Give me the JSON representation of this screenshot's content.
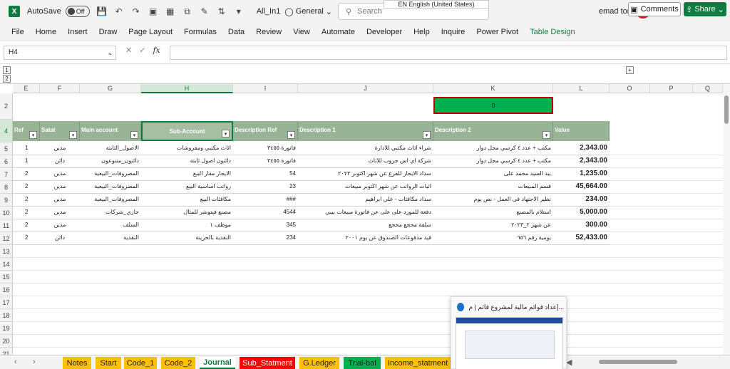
{
  "titlebar": {
    "autosave_label": "AutoSave",
    "autosave_state": "Off",
    "file_name": "All_In1",
    "sensitivity": "General",
    "search_placeholder": "Search",
    "language_popup": "EN English (United States)",
    "user_name": "emad tonsy",
    "avatar_initial": "e"
  },
  "ribbon": {
    "tabs": [
      "File",
      "Home",
      "Insert",
      "Draw",
      "Page Layout",
      "Formulas",
      "Data",
      "Review",
      "View",
      "Automate",
      "Developer",
      "Help",
      "Inquire",
      "Power Pivot",
      "Table Design"
    ],
    "comments_label": "Comments",
    "share_label": "Share"
  },
  "formula_bar": {
    "name_box": "H4",
    "formula": ""
  },
  "outline": {
    "level1": "1",
    "level2": "2",
    "expand": "+"
  },
  "columns": [
    "E",
    "F",
    "G",
    "H",
    "I",
    "J",
    "K",
    "L",
    "O",
    "P",
    "Q"
  ],
  "rows": [
    "2",
    "4",
    "5",
    "6",
    "7",
    "8",
    "9",
    "10",
    "11",
    "12",
    "13",
    "14",
    "15",
    "16",
    "17",
    "18",
    "19",
    "20",
    "21"
  ],
  "green_cell_value": "0",
  "table": {
    "headers": [
      "Ref",
      "Satat",
      "Main account",
      "Sub-Account",
      "Description Ref",
      "Description 1",
      "Description 2",
      "Value"
    ],
    "rows": [
      [
        "1",
        "مدين",
        "الاصول_الثابتة",
        "اثاث مكتبي ومفروشات",
        "فاتورة ٣٤٥٥",
        "شراء اثاث مكتبي للادارة",
        "مكتب + عدد ٤ كرسي مجل دوار",
        "2,343.00"
      ],
      [
        "1",
        "دائن",
        "دائنون_متنوعون",
        "دائنون اصول ثابتة",
        "فاتورة ٣٤٥٥",
        "شركة اي اس جروب للاثاث",
        "مكتب + عدد ٤ كرسي مجل دوار",
        "2,343.00"
      ],
      [
        "2",
        "مدين",
        "المصروفات_البيعية",
        "الايجار مقار البيع",
        "54",
        "سداد الايجار للفرع عن شهر اكتوبر ٢٠٢٣",
        "بيد السيد محمد على",
        "1,235.00"
      ],
      [
        "2",
        "مدين",
        "المصروفات_البيعية",
        "رواتب اساسية البيع",
        "23",
        "اثبات الرواتب عن شهر اكتوبر مبيعات",
        "قسم المبيعات",
        "45,664.00"
      ],
      [
        "2",
        "مدين",
        "المصروفات_البيعية",
        "مكافئات البيع",
        "###",
        "سداد مكافئات - على ابراهيم",
        "نظير الاجتهاد فى العمل - نص يوم",
        "234.00"
      ],
      [
        "2",
        "مدين",
        "جاري_شركات",
        "مصنع فيتوشر للمثال",
        "4544",
        "دفعة للمورد على على عن فاتورة مبيعات بيبي",
        "استلام بالمصنع",
        "5,000.00"
      ],
      [
        "2",
        "مدين",
        "السلف",
        "موظف ١",
        "345",
        "سلفة محجع محجع",
        "عن شهر ٢_٢٠٢٣",
        "300.00"
      ],
      [
        "2",
        "دائن",
        "النقدية",
        "النقدية بالخزينة",
        "234",
        "قيد مدفوعات الصندوق عن يوم ٢٠٠١",
        "يومية رقم ٦٥٦",
        "52,433.00"
      ]
    ]
  },
  "sheet_tabs": [
    {
      "label": "Notes",
      "color": "#ffc000"
    },
    {
      "label": "Start",
      "color": "#ffc000"
    },
    {
      "label": "Code_1",
      "color": "#ffc000"
    },
    {
      "label": "Code_2",
      "color": "#ffc000"
    },
    {
      "label": "Journal",
      "color": "#ffffff"
    },
    {
      "label": "Sub_Statment",
      "color": "#ff0000"
    },
    {
      "label": "G.Ledger",
      "color": "#ffc000"
    },
    {
      "label": "Trial-bal",
      "color": "#00b050"
    },
    {
      "label": "Income_statment",
      "color": "#ffc000"
    }
  ],
  "preview_popup": {
    "title": "إعداد قوائم مالية لمشروع قائم | م..."
  }
}
